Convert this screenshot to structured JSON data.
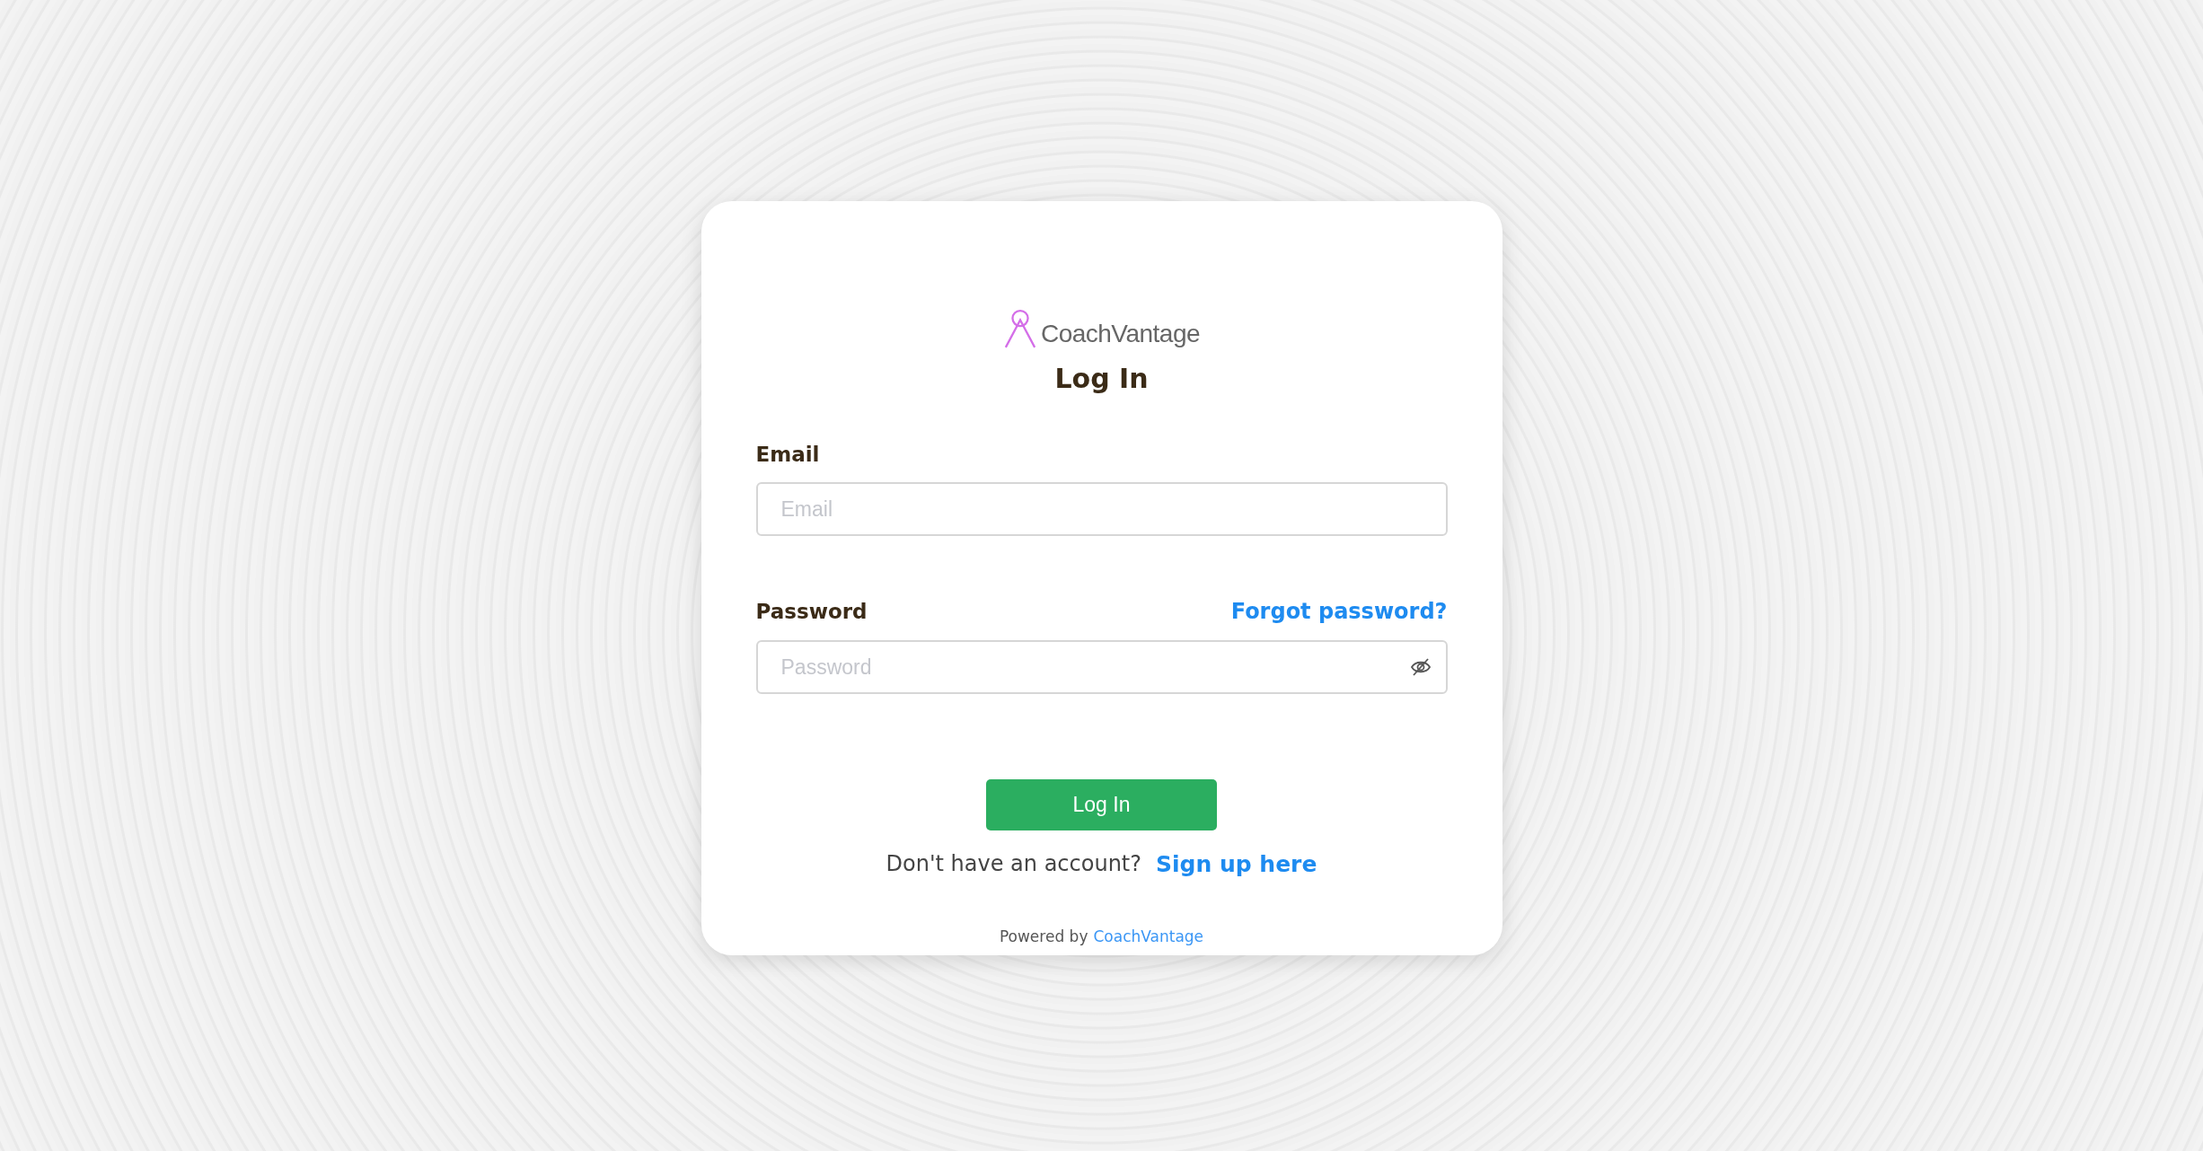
{
  "brand": {
    "name": "CoachVantage"
  },
  "title": "Log In",
  "fields": [
    {
      "kind": "email",
      "label": "Email",
      "placeholder": "Email"
    },
    {
      "kind": "password",
      "label": "Password",
      "placeholder": "Password",
      "link": "Forgot password?"
    }
  ],
  "submit": "Log In",
  "signup": {
    "text": "Don't have an account?",
    "link": "Sign up here"
  },
  "footer": {
    "text": "Powered by",
    "link": "CoachVantage"
  }
}
